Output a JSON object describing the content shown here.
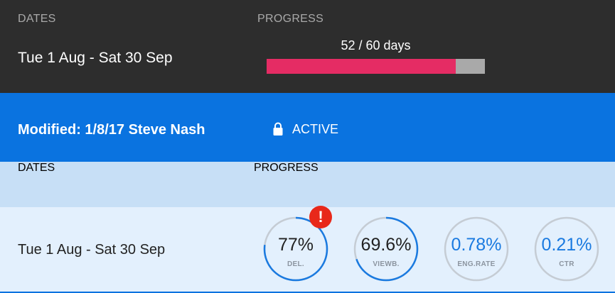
{
  "top": {
    "dates_label": "DATES",
    "progress_label": "PROGRESS",
    "dates_value": "Tue 1 Aug - Sat 30 Sep",
    "days_text": "52 / 60 days",
    "progress_fraction": 0.8667,
    "colors": {
      "background": "#2d2d2d",
      "bar_fill": "#e52c64",
      "bar_track": "#a9a9a9"
    }
  },
  "banner": {
    "modified": "Modified: 1/8/17 Steve Nash",
    "lock_icon": "lock-icon",
    "status": "ACTIVE",
    "color": "#0a73e0"
  },
  "table": {
    "dates_header": "DATES",
    "progress_header": "PROGRESS",
    "row": {
      "dates": "Tue 1 Aug - Sat 30 Sep",
      "alert_icon": "!",
      "metrics": [
        {
          "value": "77%",
          "label": "DEL.",
          "fraction": 0.77
        },
        {
          "value": "69.6%",
          "label": "VIEWB.",
          "fraction": 0.696
        },
        {
          "value": "0.78%",
          "label": "ENG.RATE",
          "fraction": 0
        },
        {
          "value": "0.21%",
          "label": "CTR",
          "fraction": 0
        }
      ]
    }
  }
}
